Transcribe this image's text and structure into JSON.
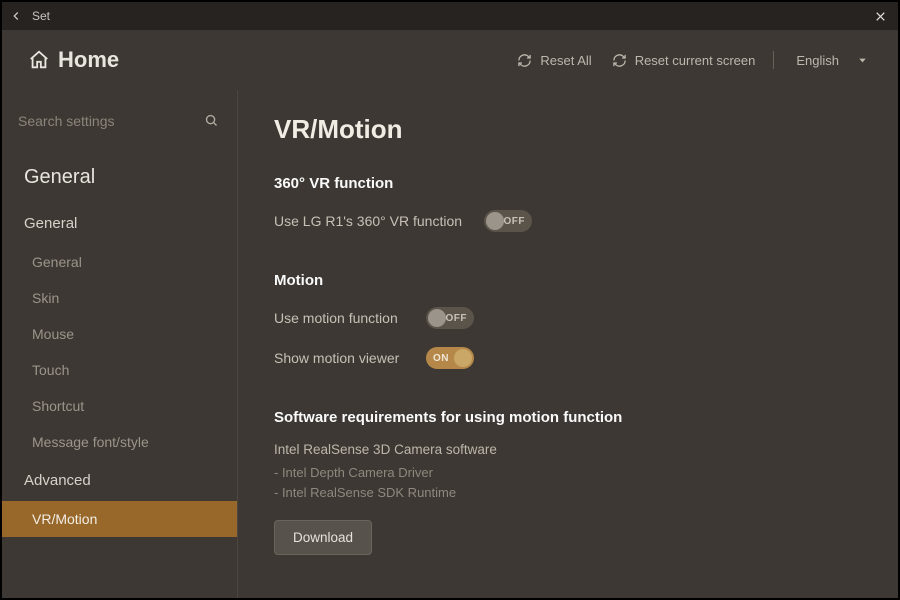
{
  "titlebar": {
    "title": "Set"
  },
  "header": {
    "home": "Home",
    "reset_all": "Reset All",
    "reset_current": "Reset current screen",
    "language": "English"
  },
  "search": {
    "placeholder": "Search settings"
  },
  "sidebar": {
    "group": "General",
    "cat_general": "General",
    "items": {
      "general": "General",
      "skin": "Skin",
      "mouse": "Mouse",
      "touch": "Touch",
      "shortcut": "Shortcut",
      "message_font": "Message font/style"
    },
    "cat_advanced": "Advanced",
    "adv_items": {
      "vr_motion": "VR/Motion"
    }
  },
  "page": {
    "title": "VR/Motion",
    "sect_vr": "360° VR function",
    "vr_use_label": "Use LG R1's 360° VR function",
    "sect_motion": "Motion",
    "motion_use_label": "Use motion function",
    "motion_viewer_label": "Show motion viewer",
    "sect_req": "Software requirements for using motion function",
    "req_sw": "Intel RealSense 3D Camera software",
    "req_1": "- Intel Depth Camera Driver",
    "req_2": "- Intel RealSense SDK Runtime",
    "download": "Download"
  },
  "toggle": {
    "on": "ON",
    "off": "OFF"
  },
  "state": {
    "vr_use": false,
    "motion_use": false,
    "motion_viewer": true
  }
}
